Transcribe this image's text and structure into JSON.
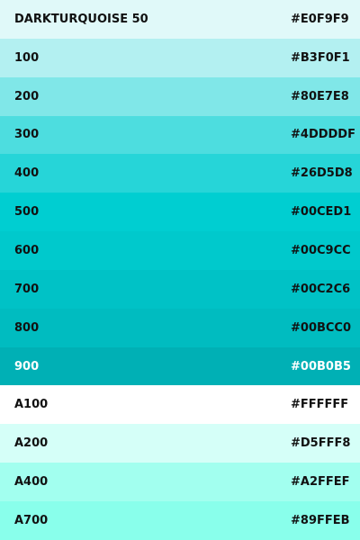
{
  "palette": {
    "swatches": [
      {
        "name": "DARKTURQUOISE 50",
        "hex": "#E0F9F9",
        "color": "#E0F9F9",
        "text_color": "#111111"
      },
      {
        "name": "100",
        "hex": "#B3F0F1",
        "color": "#B3F0F1",
        "text_color": "#111111"
      },
      {
        "name": "200",
        "hex": "#80E7E8",
        "color": "#80E7E8",
        "text_color": "#111111"
      },
      {
        "name": "300",
        "hex": "#4DDDDF",
        "color": "#4DDDDF",
        "text_color": "#111111"
      },
      {
        "name": "400",
        "hex": "#26D5D8",
        "color": "#26D5D8",
        "text_color": "#111111"
      },
      {
        "name": "500",
        "hex": "#00CED1",
        "color": "#00CED1",
        "text_color": "#111111"
      },
      {
        "name": "600",
        "hex": "#00C9CC",
        "color": "#00C9CC",
        "text_color": "#111111"
      },
      {
        "name": "700",
        "hex": "#00C2C6",
        "color": "#00C2C6",
        "text_color": "#111111"
      },
      {
        "name": "800",
        "hex": "#00BCC0",
        "color": "#00BCC0",
        "text_color": "#111111"
      },
      {
        "name": "900",
        "hex": "#00B0B5",
        "color": "#00B0B5",
        "text_color": "#ffffff"
      },
      {
        "name": "A100",
        "hex": "#FFFFFF",
        "color": "#FFFFFF",
        "text_color": "#111111"
      },
      {
        "name": "A200",
        "hex": "#D5FFF8",
        "color": "#D5FFF8",
        "text_color": "#111111"
      },
      {
        "name": "A400",
        "hex": "#A2FFEF",
        "color": "#A2FFEF",
        "text_color": "#111111"
      },
      {
        "name": "A700",
        "hex": "#89FFEB",
        "color": "#89FFEB",
        "text_color": "#111111"
      }
    ]
  }
}
